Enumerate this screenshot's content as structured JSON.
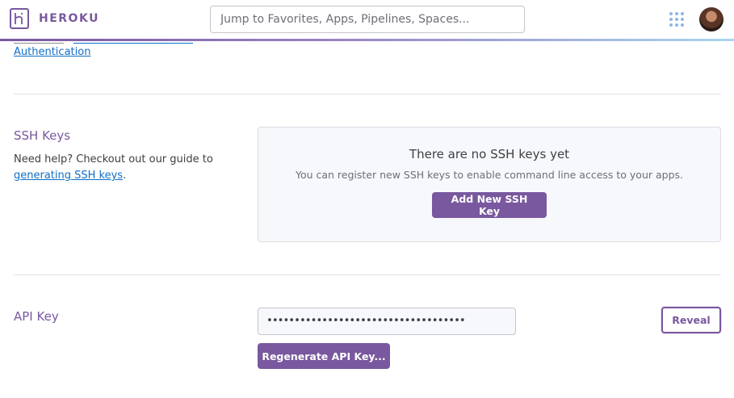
{
  "header": {
    "brand": "HEROKU",
    "search_placeholder": "Jump to Favorites, Apps, Pipelines, Spaces..."
  },
  "prev_section": {
    "link_label": "Authentication"
  },
  "ssh_keys": {
    "title": "SSH Keys",
    "help_prefix": "Need help? Checkout out our guide to",
    "help_link": "generating SSH keys",
    "help_suffix": ".",
    "empty_title": "There are no SSH keys yet",
    "empty_subtitle": "You can register new SSH keys to enable command line access to your apps.",
    "add_button": "Add New SSH Key"
  },
  "api_key": {
    "title": "API Key",
    "masked_value": "••••••••••••••••••••••••••••••••••••",
    "reveal_button": "Reveal",
    "regenerate_button": "Regenerate API Key..."
  },
  "colors": {
    "accent": "#79589f",
    "link": "#0f6fc6",
    "panel_bg": "#f7f8fb"
  },
  "icons": {
    "logo": "heroku-logo-icon",
    "apps": "apps-grid-icon"
  }
}
